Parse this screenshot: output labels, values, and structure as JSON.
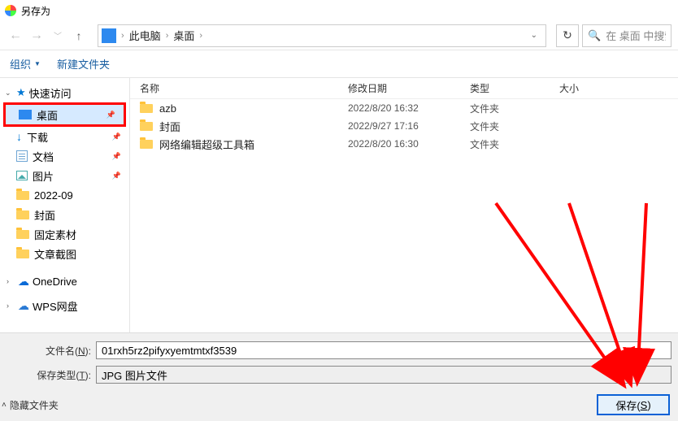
{
  "title": "另存为",
  "breadcrumbs": [
    "此电脑",
    "桌面"
  ],
  "search_placeholder": "在 桌面 中搜索",
  "toolbar": {
    "organize": "组织",
    "new_folder": "新建文件夹"
  },
  "sidebar": {
    "quick_access": "快速访问",
    "items": [
      {
        "label": "桌面",
        "icon": "desktop",
        "pinned": true,
        "highlight": true
      },
      {
        "label": "下载",
        "icon": "download",
        "pinned": true
      },
      {
        "label": "文档",
        "icon": "doc",
        "pinned": true
      },
      {
        "label": "图片",
        "icon": "pic",
        "pinned": true
      },
      {
        "label": "2022-09",
        "icon": "folder",
        "pinned": false
      },
      {
        "label": "封面",
        "icon": "folder",
        "pinned": false
      },
      {
        "label": "固定素材",
        "icon": "folder",
        "pinned": false
      },
      {
        "label": "文章截图",
        "icon": "folder",
        "pinned": false
      }
    ],
    "onedrive": "OneDrive",
    "wps": "WPS网盘"
  },
  "columns": {
    "name": "名称",
    "date": "修改日期",
    "type": "类型",
    "size": "大小"
  },
  "files": [
    {
      "name": "azb",
      "date": "2022/8/20 16:32",
      "type": "文件夹"
    },
    {
      "name": "封面",
      "date": "2022/9/27 17:16",
      "type": "文件夹"
    },
    {
      "name": "网络编辑超级工具箱",
      "date": "2022/8/20 16:30",
      "type": "文件夹"
    }
  ],
  "fields": {
    "filename_label_pre": "文件名(",
    "filename_label_u": "N",
    "filename_label_post": "):",
    "filename_value": "01rxh5rz2pifyxyemtmtxf3539",
    "filetype_label_pre": "保存类型(",
    "filetype_label_u": "T",
    "filetype_label_post": "):",
    "filetype_value": "JPG 图片文件"
  },
  "footer": {
    "hide_folders": "隐藏文件夹",
    "save_pre": "保存(",
    "save_u": "S",
    "save_post": ")"
  }
}
